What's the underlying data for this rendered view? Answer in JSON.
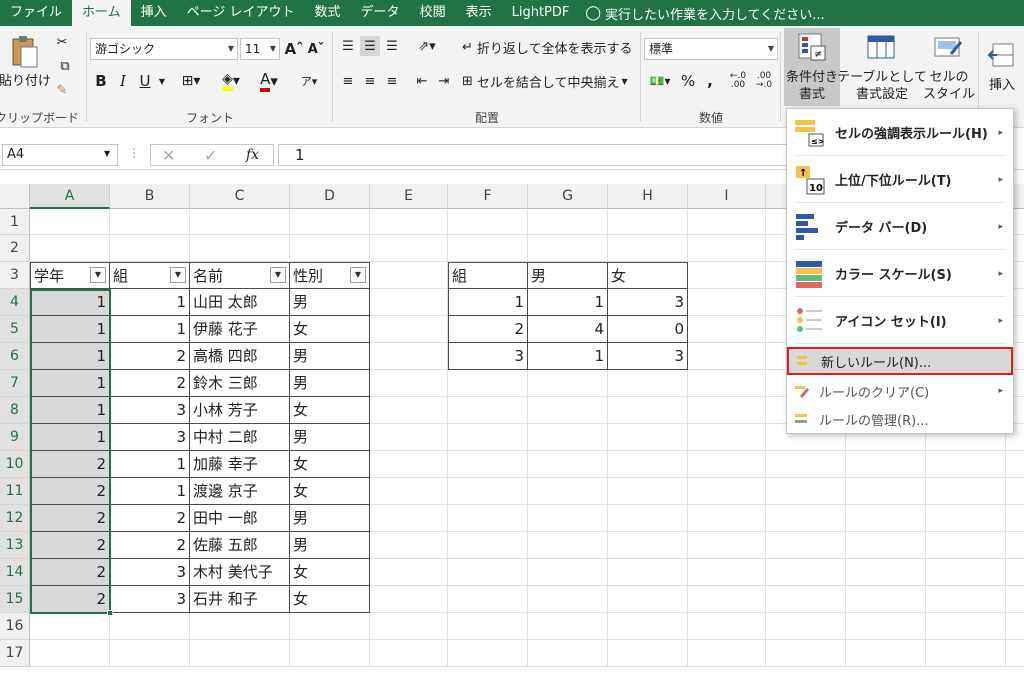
{
  "menu": {
    "tabs": [
      "ファイル",
      "ホーム",
      "挿入",
      "ページ レイアウト",
      "数式",
      "データ",
      "校閲",
      "表示",
      "LightPDF"
    ],
    "tell_me": "実行したい作業を入力してください..."
  },
  "ribbon": {
    "clipboard": {
      "paste": "貼り付け",
      "label": "クリップボード"
    },
    "font": {
      "name": "游ゴシック",
      "size": "11",
      "bold": "B",
      "italic": "I",
      "underline": "U",
      "label": "フォント"
    },
    "align": {
      "wrap": "折り返して全体を表示する",
      "merge": "セルを結合して中央揃え",
      "label": "配置"
    },
    "number": {
      "format": "標準",
      "label": "数値"
    },
    "styles": {
      "cond": [
        "条件付き",
        "書式"
      ],
      "table": [
        "テーブルとして",
        "書式設定"
      ],
      "cell": [
        "セルの",
        "スタイル"
      ]
    },
    "cells": {
      "insert": "挿入"
    }
  },
  "formula": {
    "namebox": "A4",
    "fx": "fx",
    "value": "1"
  },
  "columns": [
    "A",
    "B",
    "C",
    "D",
    "E",
    "F",
    "G",
    "H",
    "I"
  ],
  "rows": [
    "1",
    "2",
    "3",
    "4",
    "5",
    "6",
    "7",
    "8",
    "9",
    "10",
    "11",
    "12",
    "13",
    "14",
    "15",
    "16",
    "17"
  ],
  "table1": {
    "headers": [
      "学年",
      "組",
      "名前",
      "性別"
    ],
    "rows": [
      [
        "1",
        "1",
        "山田 太郎",
        "男"
      ],
      [
        "1",
        "1",
        "伊藤 花子",
        "女"
      ],
      [
        "1",
        "2",
        "高橋 四郎",
        "男"
      ],
      [
        "1",
        "2",
        "鈴木 三郎",
        "男"
      ],
      [
        "1",
        "3",
        "小林 芳子",
        "女"
      ],
      [
        "1",
        "3",
        "中村 二郎",
        "男"
      ],
      [
        "2",
        "1",
        "加藤 幸子",
        "女"
      ],
      [
        "2",
        "1",
        "渡邊 京子",
        "女"
      ],
      [
        "2",
        "2",
        "田中 一郎",
        "男"
      ],
      [
        "2",
        "2",
        "佐藤 五郎",
        "男"
      ],
      [
        "2",
        "3",
        "木村 美代子",
        "女"
      ],
      [
        "2",
        "3",
        "石井 和子",
        "女"
      ]
    ]
  },
  "table2": {
    "headers": [
      "組",
      "男",
      "女"
    ],
    "rows": [
      [
        "1",
        "1",
        "3"
      ],
      [
        "2",
        "4",
        "0"
      ],
      [
        "3",
        "1",
        "3"
      ]
    ]
  },
  "dropdown": {
    "items": [
      {
        "label": "セルの強調表示ルール(H)",
        "icon": "highlight-rules-icon"
      },
      {
        "label": "上位/下位ルール(T)",
        "icon": "top-bottom-icon"
      },
      {
        "label": "データ バー(D)",
        "icon": "data-bar-icon"
      },
      {
        "label": "カラー スケール(S)",
        "icon": "color-scale-icon"
      },
      {
        "label": "アイコン セット(I)",
        "icon": "icon-set-icon"
      },
      {
        "label": "新しいルール(N)...",
        "icon": "new-rule-icon"
      },
      {
        "label": "ルールのクリア(C)",
        "icon": "clear-rules-icon"
      },
      {
        "label": "ルールの管理(R)...",
        "icon": "manage-rules-icon"
      }
    ]
  }
}
